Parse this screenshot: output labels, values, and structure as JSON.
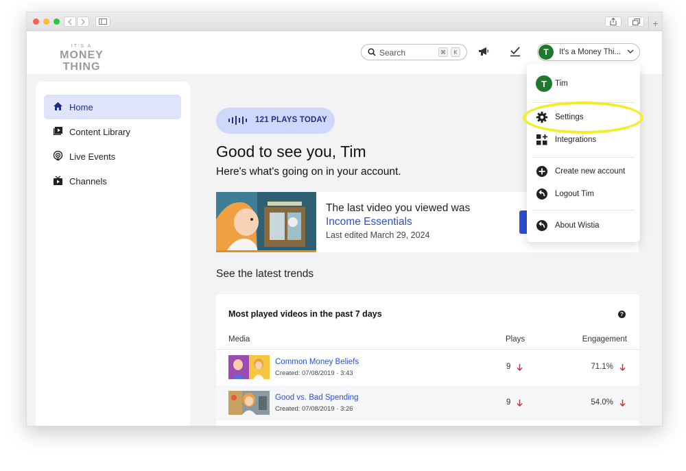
{
  "browser": {
    "plus": "+"
  },
  "header": {
    "logo_top": "IT'S A",
    "logo_main": "MONEY THING",
    "search_placeholder": "Search",
    "search_key1": "⌘",
    "search_key2": "K",
    "account_avatar": "T",
    "account_name": "It's a Money Thi..."
  },
  "sidebar": {
    "items": [
      {
        "label": "Home",
        "icon": "home-icon",
        "active": true
      },
      {
        "label": "Content Library",
        "icon": "content-library-icon",
        "active": false
      },
      {
        "label": "Live Events",
        "icon": "live-events-icon",
        "active": false
      },
      {
        "label": "Channels",
        "icon": "channels-icon",
        "active": false
      }
    ]
  },
  "main": {
    "plays_today": "121 PLAYS TODAY",
    "greeting": "Good to see you, Tim",
    "subgreeting": "Here's what's going on in your account.",
    "last_video": {
      "intro": "The last video you viewed was",
      "title": "Income Essentials",
      "edited": "Last edited March 29, 2024"
    },
    "trends_title": "See the latest trends",
    "table": {
      "title": "Most played videos in the past 7 days",
      "help": "?",
      "columns": [
        "Media",
        "Plays",
        "Engagement"
      ],
      "rows": [
        {
          "title": "Common Money Beliefs",
          "meta": "Created: 07/08/2019 · 3:43",
          "plays": "9",
          "engagement": "71.1%"
        },
        {
          "title": "Good vs. Bad Spending",
          "meta": "Created: 07/08/2019 · 3:26",
          "plays": "9",
          "engagement": "54.0%"
        }
      ]
    }
  },
  "dropdown": {
    "user_avatar": "T",
    "user_name": "Tim",
    "items": [
      "Settings",
      "Integrations",
      "Create new account",
      "Logout Tim",
      "About Wistia"
    ]
  },
  "colors": {
    "accent": "#2a4fd6",
    "avatar": "#1d7a2a",
    "highlight": "#f2ee25",
    "down_arrow": "#d62a3a"
  }
}
